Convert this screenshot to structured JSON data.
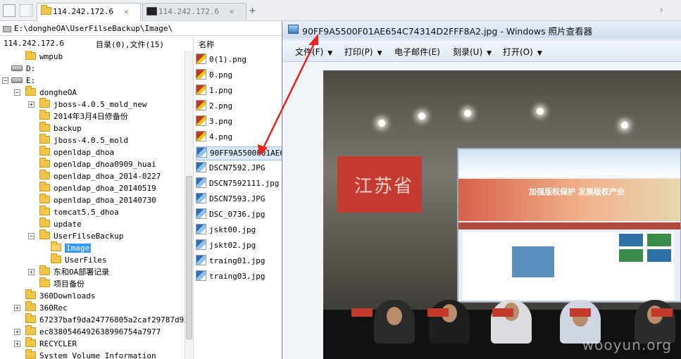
{
  "tabs": [
    {
      "title": "114.242.172.6",
      "type": "folder",
      "active": true
    },
    {
      "title": "114.242.172.6",
      "type": "terminal",
      "active": false
    }
  ],
  "path": "E:\\dongheOA\\UserFilseBackup\\Image\\",
  "left_header": {
    "host": "114.242.172.6",
    "summary": "目录(0),文件(15)"
  },
  "right_header": {
    "name_col": "名称"
  },
  "tree": [
    {
      "label": "wmpub",
      "level": 2,
      "kind": "folder",
      "exp": ""
    },
    {
      "label": "D:",
      "level": 1,
      "kind": "drive",
      "exp": ""
    },
    {
      "label": "E:",
      "level": 1,
      "kind": "drive",
      "exp": "-"
    },
    {
      "label": "dongheOA",
      "level": 2,
      "kind": "folder",
      "exp": "-"
    },
    {
      "label": "jboss-4.0.5_mold_new",
      "level": 3,
      "kind": "folder",
      "exp": "+"
    },
    {
      "label": "2014年3月4日修备份",
      "level": 3,
      "kind": "folder",
      "exp": ""
    },
    {
      "label": "backup",
      "level": 3,
      "kind": "folder",
      "exp": ""
    },
    {
      "label": "jboss-4.0.5_mold",
      "level": 3,
      "kind": "folder",
      "exp": ""
    },
    {
      "label": "openldap_dhoa",
      "level": 3,
      "kind": "folder",
      "exp": ""
    },
    {
      "label": "openldap_dhoa0909_huai",
      "level": 3,
      "kind": "folder",
      "exp": ""
    },
    {
      "label": "openldap_dhoa_2014-0227",
      "level": 3,
      "kind": "folder",
      "exp": ""
    },
    {
      "label": "openldap_dhoa_20140519",
      "level": 3,
      "kind": "folder",
      "exp": ""
    },
    {
      "label": "openldap_dhoa_20140730",
      "level": 3,
      "kind": "folder",
      "exp": ""
    },
    {
      "label": "tomcat5.5_dhoa",
      "level": 3,
      "kind": "folder",
      "exp": ""
    },
    {
      "label": "update",
      "level": 3,
      "kind": "folder",
      "exp": ""
    },
    {
      "label": "UserFilseBackup",
      "level": 3,
      "kind": "folder",
      "exp": "-"
    },
    {
      "label": "Image",
      "level": 4,
      "kind": "folder",
      "exp": "",
      "selected": true
    },
    {
      "label": "UserFiles",
      "level": 4,
      "kind": "folder",
      "exp": ""
    },
    {
      "label": "东和OA部署记录",
      "level": 3,
      "kind": "folder",
      "exp": "+"
    },
    {
      "label": "项目备份",
      "level": 3,
      "kind": "folder",
      "exp": ""
    },
    {
      "label": "360Downloads",
      "level": 2,
      "kind": "folder",
      "exp": ""
    },
    {
      "label": "360Rec",
      "level": 2,
      "kind": "folder",
      "exp": "+"
    },
    {
      "label": "67237baf9da24776805a2caf29787d97",
      "level": 2,
      "kind": "folder",
      "exp": ""
    },
    {
      "label": "ec8380546492638996754a7977",
      "level": 2,
      "kind": "folder",
      "exp": "+"
    },
    {
      "label": "RECYCLER",
      "level": 2,
      "kind": "folder",
      "exp": "+"
    },
    {
      "label": "System Volume Information",
      "level": 2,
      "kind": "folder",
      "exp": ""
    }
  ],
  "files": [
    {
      "name": "0(1).png",
      "type": "png"
    },
    {
      "name": "0.png",
      "type": "png"
    },
    {
      "name": "1.png",
      "type": "png"
    },
    {
      "name": "2.png",
      "type": "png"
    },
    {
      "name": "3.png",
      "type": "png"
    },
    {
      "name": "4.png",
      "type": "png"
    },
    {
      "name": "90FF9A5500F01AE65",
      "type": "jpg",
      "selected": true
    },
    {
      "name": "DSCN7592.JPG",
      "type": "jpg"
    },
    {
      "name": "DSCN7592111.jpg",
      "type": "jpg"
    },
    {
      "name": "DSCN7593.JPG",
      "type": "jpg"
    },
    {
      "name": "DSC_0736.jpg",
      "type": "jpg"
    },
    {
      "name": "jskt00.jpg",
      "type": "jpg"
    },
    {
      "name": "jskt02.jpg",
      "type": "jpg"
    },
    {
      "name": "traing01.jpg",
      "type": "jpg"
    },
    {
      "name": "traing03.jpg",
      "type": "jpg"
    }
  ],
  "viewer": {
    "title": "90FF9A5500F01AE654C74314D2FFF8A2.jpg - Windows 照片查看器",
    "menu": [
      "文件(F)",
      "打印(P)",
      "电子邮件(E)",
      "刻录(U)",
      "打开(O)"
    ],
    "photo_banner": "江苏省",
    "screen_caption": "加强版权保护 发展版权产业",
    "watermark": "wooyun.org"
  },
  "colors": {
    "selection": "#3399ff",
    "arrow": "#e8231c",
    "folder": "#f0c64a"
  }
}
